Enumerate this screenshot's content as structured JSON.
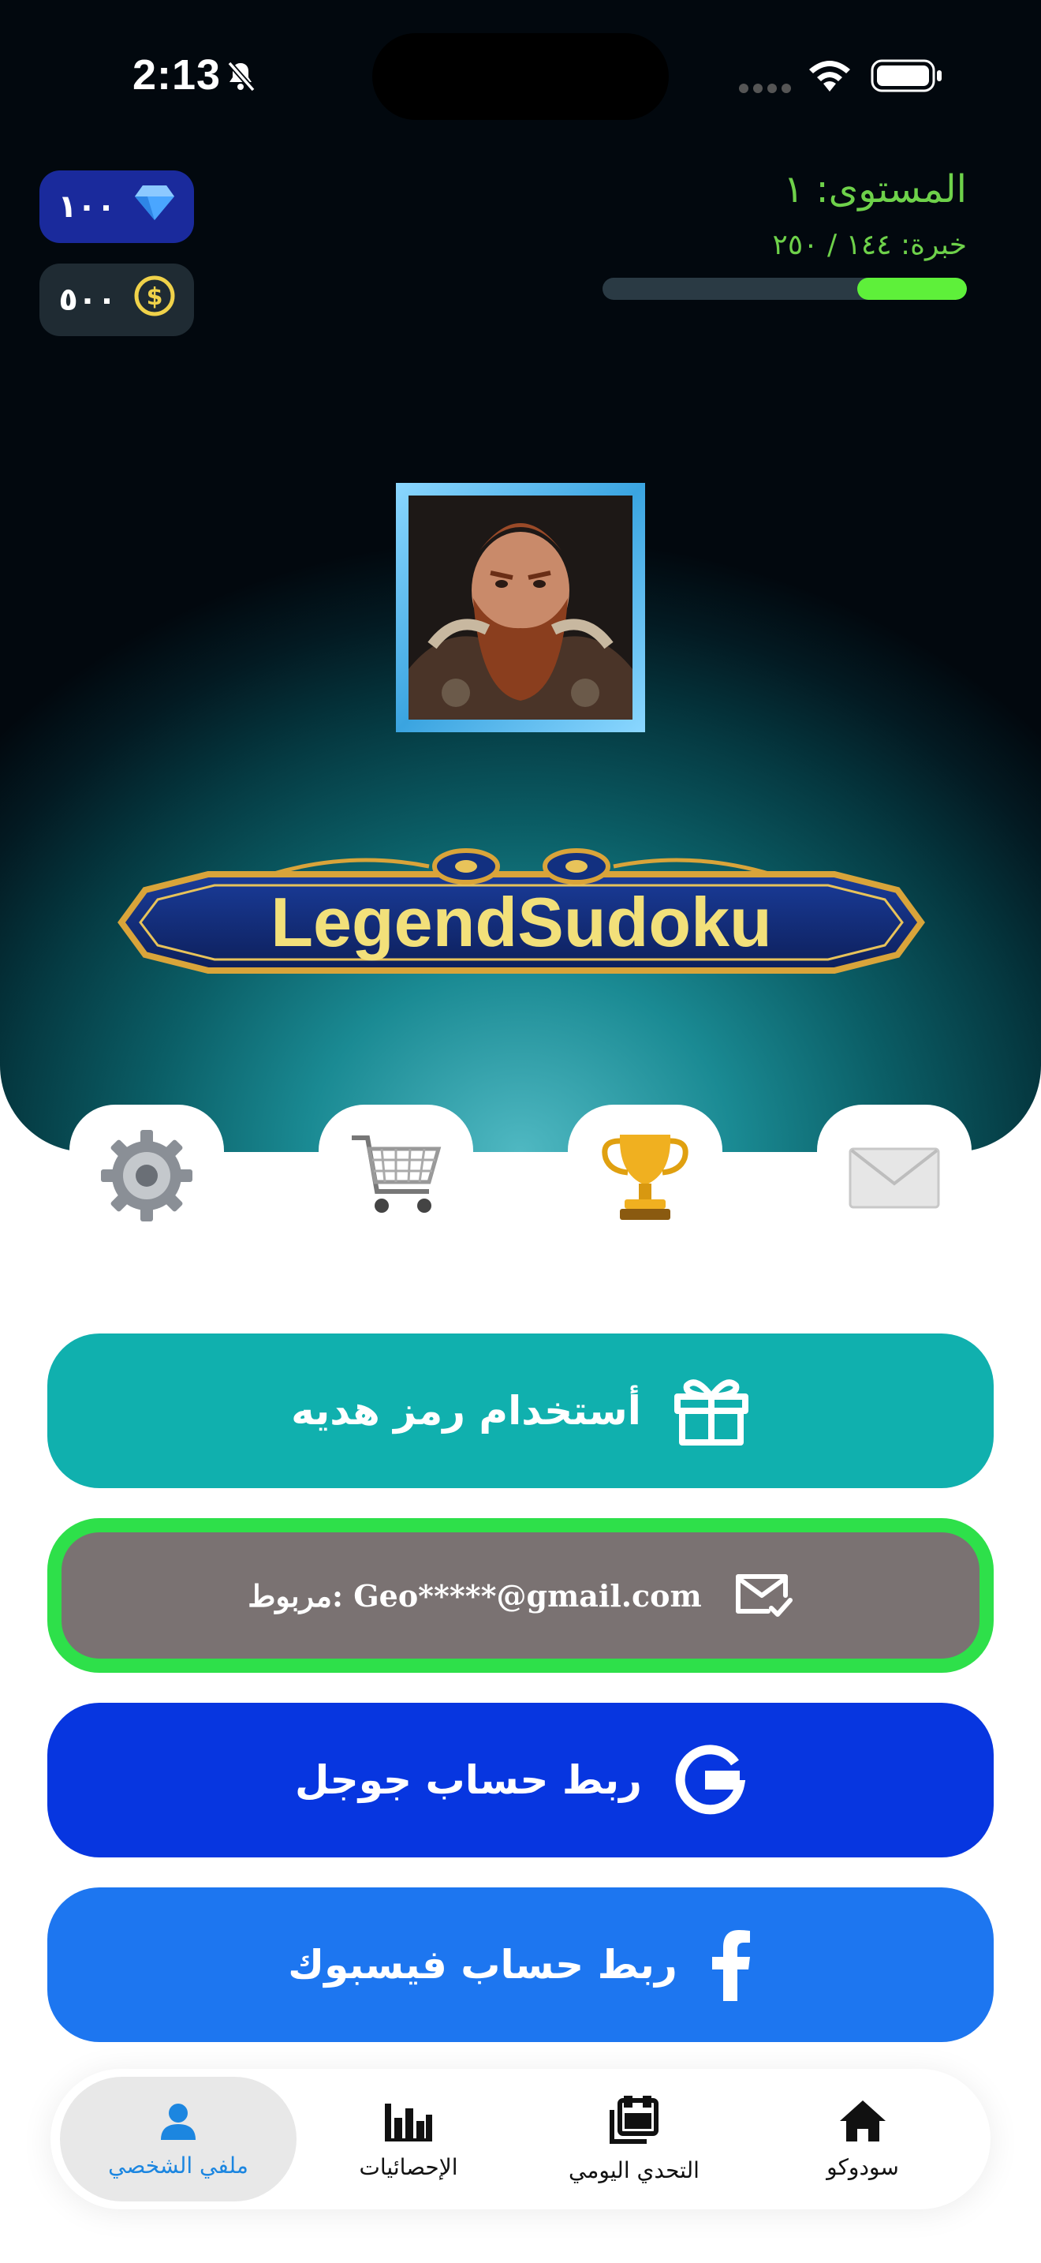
{
  "status_bar": {
    "time": "2:13"
  },
  "currency": {
    "gems": "١٠٠",
    "coins": "٥٠٠"
  },
  "player": {
    "level_label": "المستوى: ١",
    "xp_label": "خبرة: ١٤٤ / ٢٥٠",
    "xp_fraction": 0.3,
    "name": "LegendSudoku"
  },
  "tabs": [
    {
      "name": "settings",
      "icon": "gear-icon"
    },
    {
      "name": "shop",
      "icon": "cart-icon"
    },
    {
      "name": "trophies",
      "icon": "trophy-icon"
    },
    {
      "name": "mail",
      "icon": "envelope-icon"
    }
  ],
  "actions": {
    "redeem_gift_label": "أستخدام رمز هديه",
    "linked_email_label": "مربوط: Geo*****@gmail.com",
    "link_google_label": "ربط حساب جوجل",
    "link_facebook_label": "ربط حساب فيسبوك"
  },
  "bottom_nav": {
    "profile": "ملفي الشخصي",
    "stats": "الإحصائيات",
    "daily": "التحدي اليومي",
    "home": "سودوكو"
  },
  "colors": {
    "gift_button": "#10b0ae",
    "email_button": "#7a7272",
    "email_border": "#2ee04a",
    "google_button": "#0736e0",
    "facebook_button": "#1d76f0",
    "xp_fill": "#5ef03a",
    "level_text": "#6ed14a",
    "nav_active": "#1c86e0"
  }
}
